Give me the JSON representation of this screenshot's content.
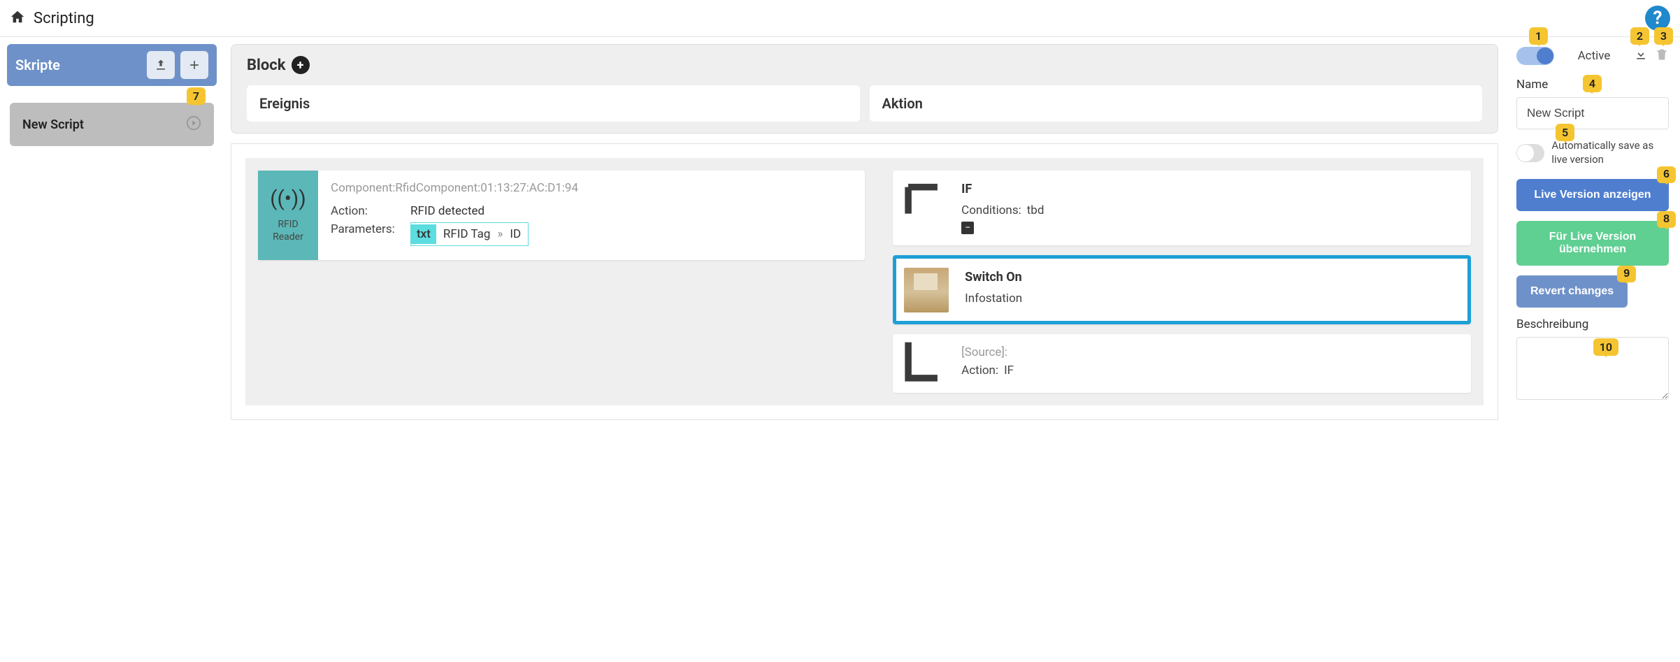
{
  "topbar": {
    "title": "Scripting"
  },
  "sidebar": {
    "title": "Skripte",
    "scripts": [
      {
        "label": "New Script"
      }
    ]
  },
  "block": {
    "title": "Block",
    "event_header": "Ereignis",
    "action_header": "Aktion"
  },
  "event_card": {
    "icon_label": "RFID Reader",
    "component": "Component:RfidComponent:01:13:27:AC:D1:94",
    "action_label": "Action:",
    "action_value": "RFID detected",
    "params_label": "Parameters:",
    "param_tag": "txt",
    "param_text": "RFID Tag",
    "param_id": "ID"
  },
  "actions": {
    "if_card": {
      "title": "IF",
      "cond_label": "Conditions:",
      "cond_value": "tbd"
    },
    "switch_card": {
      "title": "Switch On",
      "target": "Infostation"
    },
    "source_card": {
      "source_label": "[Source]:",
      "action_label": "Action:",
      "action_value": "IF"
    }
  },
  "rpanel": {
    "active_label": "Active",
    "name_label": "Name",
    "name_value": "New Script",
    "autosave_label": "Automatically save as live version",
    "btn_live_show": "Live Version anzeigen",
    "btn_adopt": "Für Live Version übernehmen",
    "btn_revert": "Revert changes",
    "desc_label": "Beschreibung"
  },
  "callouts": {
    "c1": "1",
    "c2": "2",
    "c3": "3",
    "c4": "4",
    "c5": "5",
    "c6": "6",
    "c7": "7",
    "c8": "8",
    "c9": "9",
    "c10": "10"
  }
}
